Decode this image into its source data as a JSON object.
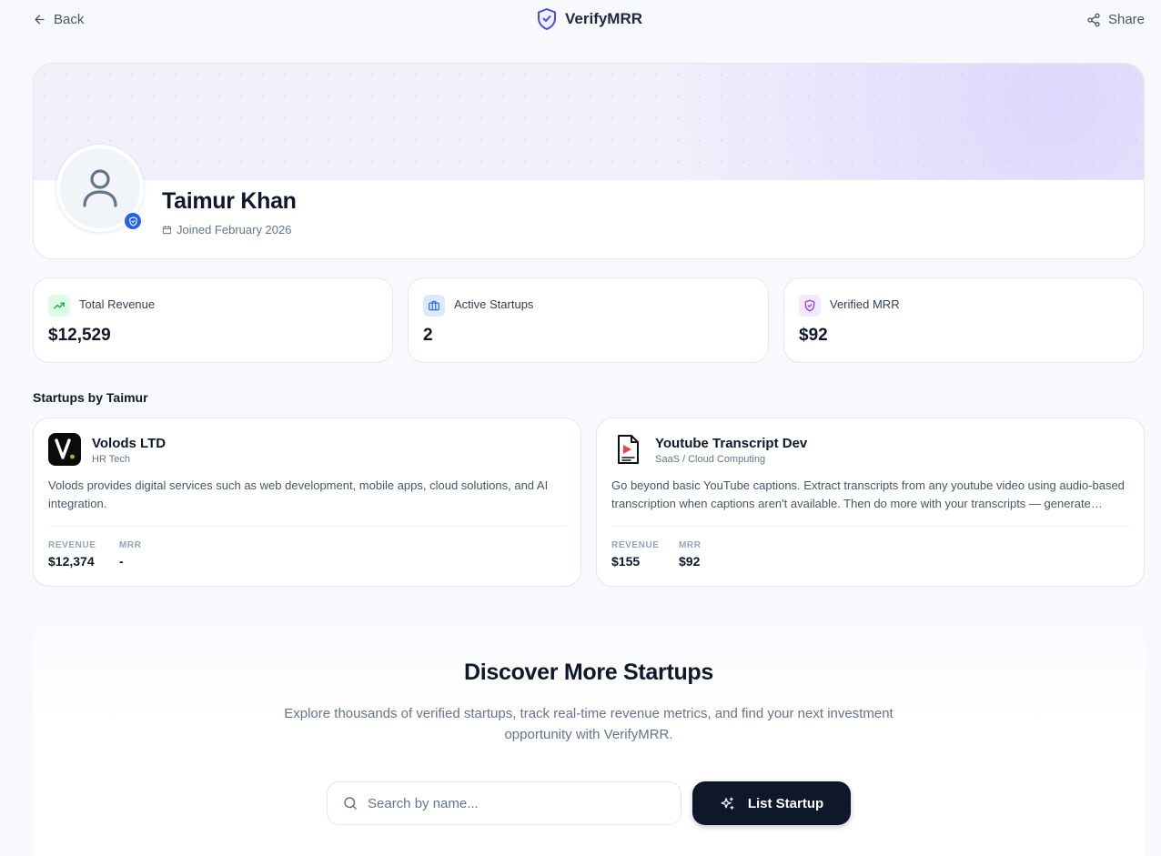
{
  "header": {
    "back_label": "Back",
    "brand_name": "VerifyMRR",
    "share_label": "Share"
  },
  "profile": {
    "name": "Taimur Khan",
    "joined": "Joined February 2026"
  },
  "stats": [
    {
      "label": "Total Revenue",
      "value": "$12,529",
      "icon": "trending-up-icon",
      "color": "#16a34a"
    },
    {
      "label": "Active Startups",
      "value": "2",
      "icon": "briefcase-icon",
      "color": "#2563eb"
    },
    {
      "label": "Verified MRR",
      "value": "$92",
      "icon": "shield-check-icon",
      "color": "#9333ea"
    }
  ],
  "startups_section": {
    "title": "Startups by Taimur",
    "items": [
      {
        "name": "Volods LTD",
        "category": "HR Tech",
        "description": "Volods provides digital services such as web development, mobile apps, cloud solutions, and AI integration.",
        "revenue_label": "REVENUE",
        "revenue": "$12,374",
        "mrr_label": "MRR",
        "mrr": "-",
        "logo_letter": "V."
      },
      {
        "name": "Youtube Transcript Dev",
        "category": "SaaS / Cloud Computing",
        "description": "Go beyond basic YouTube captions. Extract transcripts from any youtube video using audio-based transcription when captions aren't available. Then do more with your transcripts — generate summaries, translations and more.",
        "revenue_label": "REVENUE",
        "revenue": "$155",
        "mrr_label": "MRR",
        "mrr": "$92"
      }
    ]
  },
  "discover": {
    "title": "Discover More Startups",
    "subtitle": "Explore thousands of verified startups, track real-time revenue metrics, and find your next investment opportunity with VerifyMRR.",
    "search_placeholder": "Search by name...",
    "list_button": "List Startup"
  },
  "colors": {
    "brand": "#4f46e5",
    "verified_badge": "#2563eb",
    "dark_button": "#0f172a"
  }
}
